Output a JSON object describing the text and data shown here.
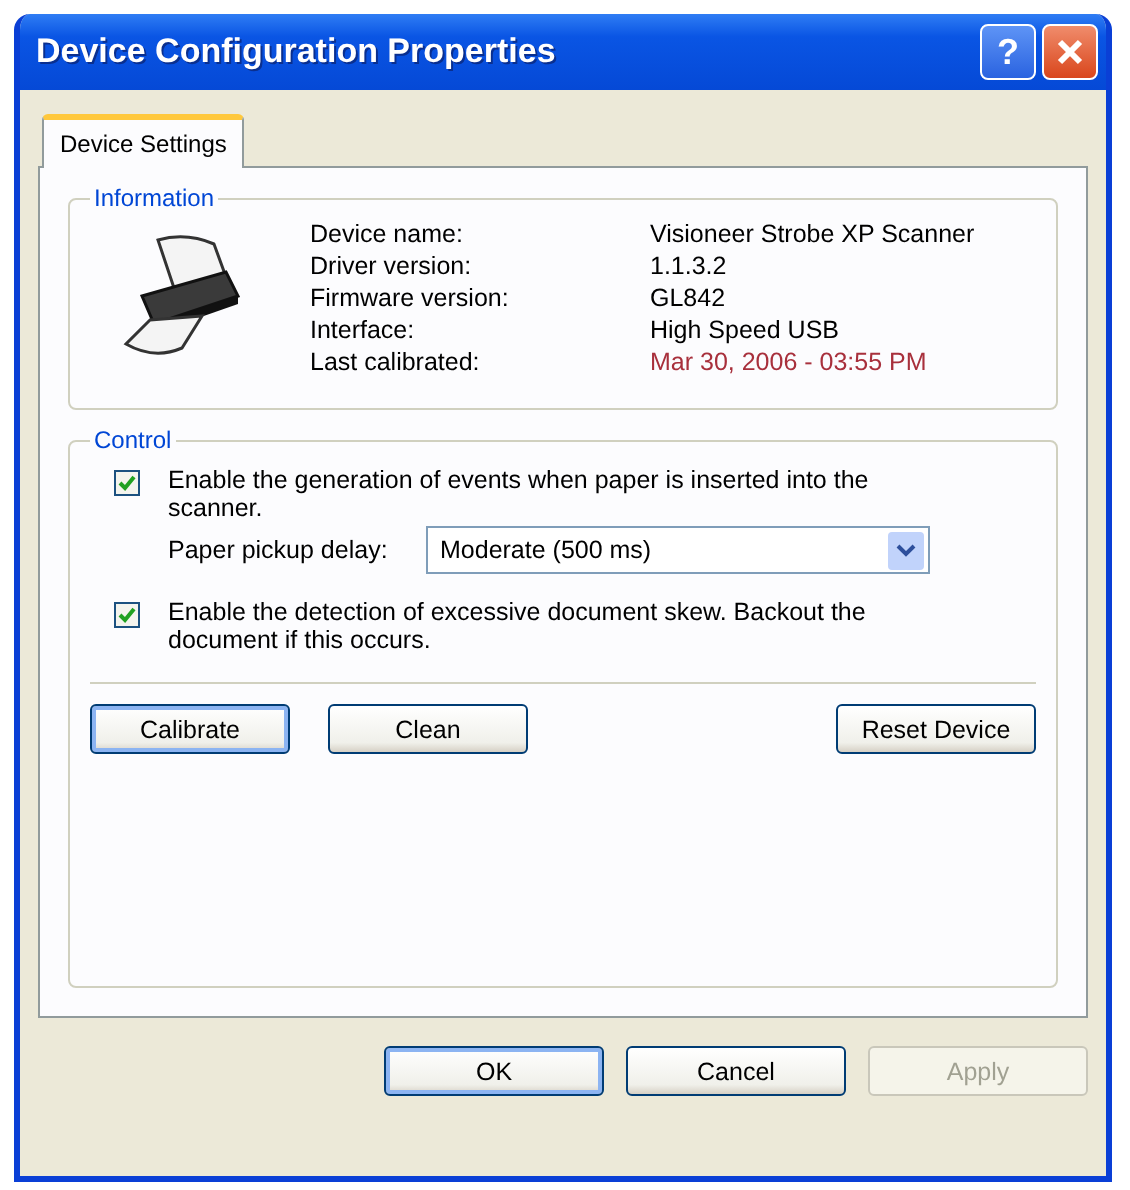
{
  "window": {
    "title": "Device Configuration Properties",
    "help_button": "?"
  },
  "tabs": [
    {
      "label": "Device Settings",
      "selected": true
    }
  ],
  "information": {
    "title": "Information",
    "rows": [
      {
        "label": "Device name:",
        "value": "Visioneer Strobe XP Scanner",
        "color": "#000000"
      },
      {
        "label": "Driver version:",
        "value": "1.1.3.2",
        "color": "#000000"
      },
      {
        "label": "Firmware version:",
        "value": "GL842",
        "color": "#000000"
      },
      {
        "label": "Interface:",
        "value": "High Speed USB",
        "color": "#000000"
      },
      {
        "label": "Last calibrated:",
        "value": "Mar 30, 2006 - 03:55 PM",
        "color": "#a8303c"
      }
    ]
  },
  "control": {
    "title": "Control",
    "event_option": {
      "label": "Enable the generation of events when paper is inserted into the scanner.",
      "checked": true
    },
    "pickup_delay": {
      "label": "Paper pickup delay:",
      "value": "Moderate (500 ms)"
    },
    "skew_option": {
      "label": "Enable the detection of excessive document skew. Backout the document if this occurs.",
      "checked": true
    },
    "buttons": [
      {
        "label": "Calibrate",
        "focused": true
      },
      {
        "label": "Clean",
        "focused": false
      },
      {
        "label": "Reset Device",
        "focused": false
      }
    ]
  },
  "dialog_buttons": [
    {
      "label": "OK",
      "focused": true,
      "disabled": false
    },
    {
      "label": "Cancel",
      "focused": false,
      "disabled": false
    },
    {
      "label": "Apply",
      "focused": false,
      "disabled": true
    }
  ]
}
